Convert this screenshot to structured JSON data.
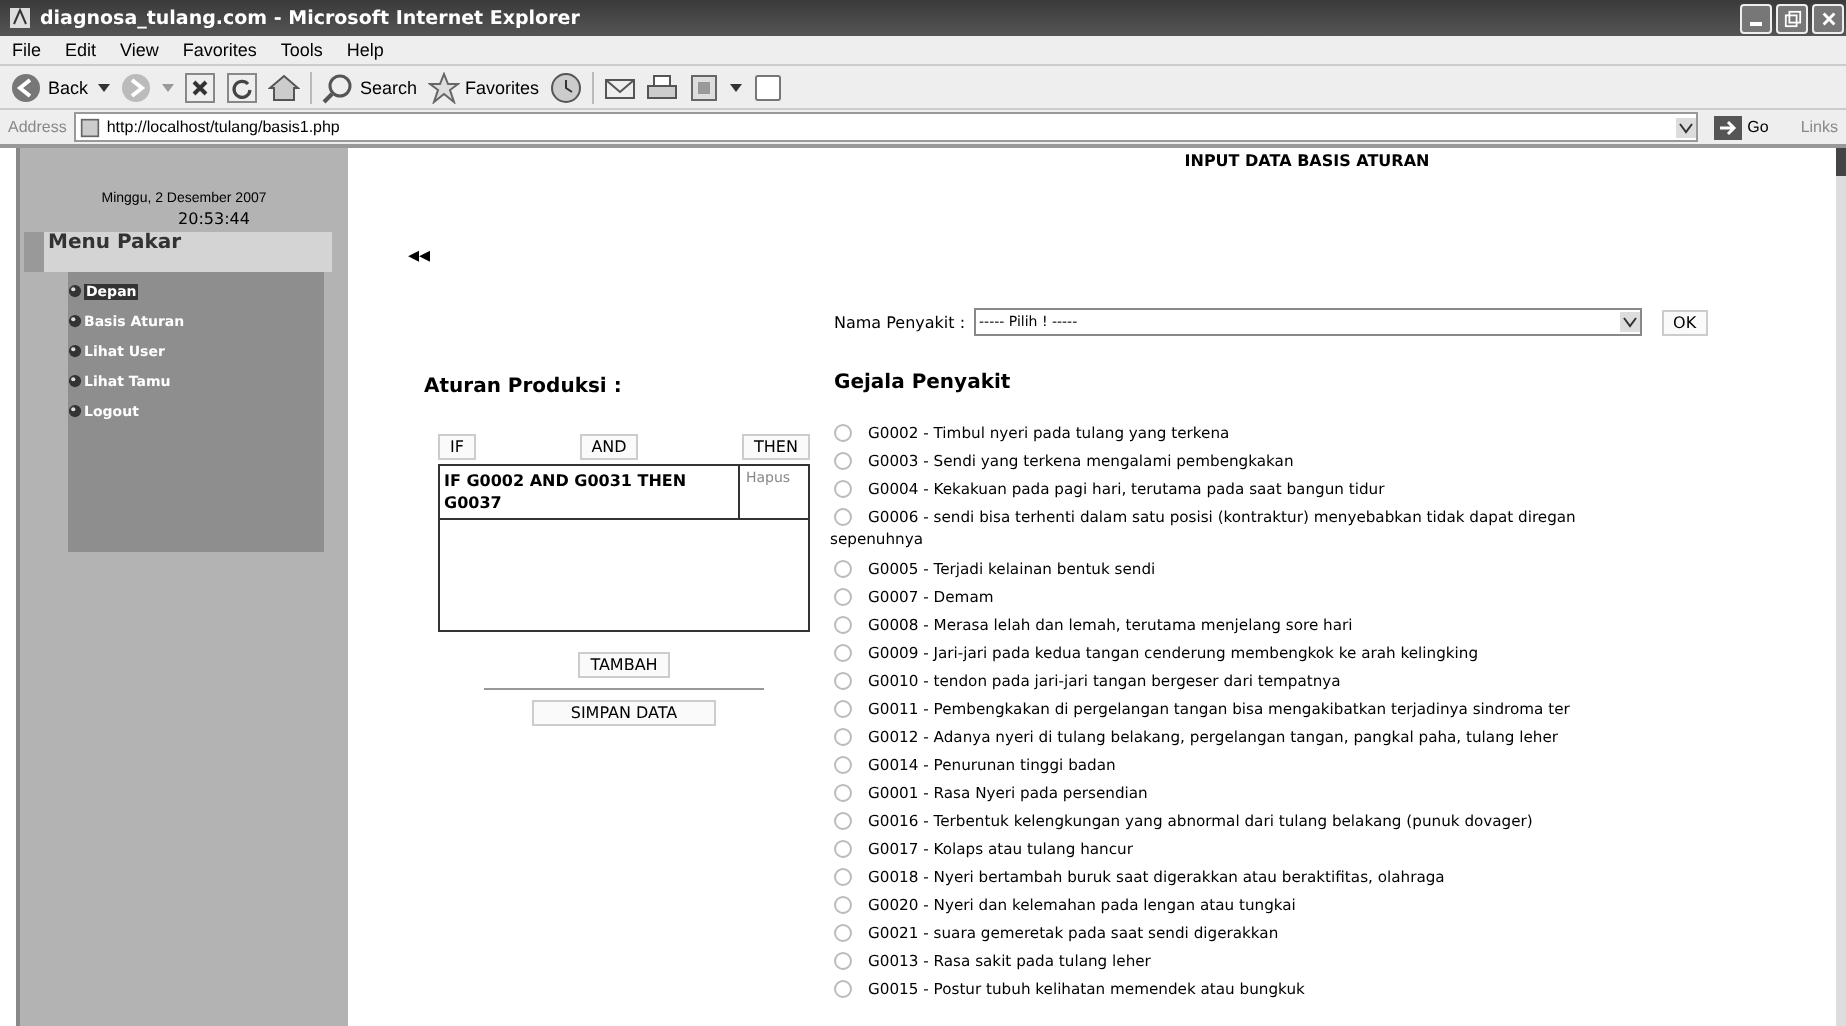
{
  "window": {
    "title": "diagnosa_tulang.com - Microsoft Internet Explorer"
  },
  "menu_bar": [
    "File",
    "Edit",
    "View",
    "Favorites",
    "Tools",
    "Help"
  ],
  "toolbar": {
    "back": "Back",
    "search": "Search",
    "favorites": "Favorites"
  },
  "address_bar": {
    "label": "Address",
    "url": "http://localhost/tulang/basis1.php",
    "go": "Go",
    "links": "Links"
  },
  "sidebar": {
    "date": "Minggu, 2 Desember 2007",
    "time": "20:53:44",
    "menu_title": "Menu Pakar",
    "items": [
      {
        "label": "Depan",
        "selected": true
      },
      {
        "label": "Basis Aturan",
        "selected": false
      },
      {
        "label": "Lihat User",
        "selected": false
      },
      {
        "label": "Lihat Tamu",
        "selected": false
      },
      {
        "label": "Logout",
        "selected": false
      }
    ]
  },
  "page": {
    "title": "INPUT DATA BASIS ATURAN",
    "back_arrows": "◂◂"
  },
  "disease_select": {
    "label": "Nama Penyakit :",
    "value": "----- Pilih ! -----",
    "ok": "OK"
  },
  "rules": {
    "heading": "Aturan Produksi :",
    "header_buttons": [
      "IF",
      "AND",
      "THEN"
    ],
    "rows": [
      {
        "rule": "IF G0002 AND G0031 THEN G0037",
        "action": "Hapus"
      }
    ],
    "add": "TAMBAH",
    "save": "SIMPAN DATA"
  },
  "symptoms": {
    "heading": "Gejala Penyakit",
    "items": [
      {
        "text": "G0002 - Timbul nyeri pada tulang yang terkena",
        "selected": false
      },
      {
        "text": "G0003 - Sendi yang terkena mengalami pembengkakan",
        "selected": false
      },
      {
        "text": "G0004 - Kekakuan pada pagi hari, terutama pada saat bangun tidur",
        "selected": false
      },
      {
        "text": "G0006 - sendi bisa terhenti dalam satu posisi (kontraktur) menyebabkan tidak dapat diregan",
        "continuation": "sepenuhnya",
        "selected": false
      },
      {
        "text": "G0005 - Terjadi kelainan bentuk sendi",
        "selected": false
      },
      {
        "text": "G0007 - Demam",
        "selected": false
      },
      {
        "text": "G0008 - Merasa lelah dan lemah, terutama menjelang sore hari",
        "selected": false
      },
      {
        "text": "G0009 - Jari-jari pada kedua tangan cenderung membengkok ke arah kelingking",
        "selected": false
      },
      {
        "text": "G0010 - tendon pada jari-jari tangan bergeser dari tempatnya",
        "selected": false
      },
      {
        "text": "G0011 - Pembengkakan di pergelangan tangan bisa mengakibatkan terjadinya sindroma ter",
        "selected": false
      },
      {
        "text": "G0012 - Adanya nyeri di tulang belakang, pergelangan tangan, pangkal paha, tulang leher",
        "selected": false
      },
      {
        "text": "G0014 - Penurunan tinggi badan",
        "selected": false
      },
      {
        "text": "G0001 - Rasa Nyeri pada persendian",
        "selected": false
      },
      {
        "text": "G0016 - Terbentuk kelengkungan yang abnormal dari tulang belakang (punuk dovager)",
        "selected": false
      },
      {
        "text": "G0017 - Kolaps atau tulang hancur",
        "selected": false
      },
      {
        "text": "G0018 - Nyeri bertambah buruk saat digerakkan atau beraktifitas, olahraga",
        "selected": false
      },
      {
        "text": "G0020 - Nyeri dan kelemahan pada lengan atau tungkai",
        "selected": false
      },
      {
        "text": "G0021 - suara gemeretak pada saat sendi digerakkan",
        "selected": false
      },
      {
        "text": "G0013 - Rasa sakit pada tulang leher",
        "selected": false
      },
      {
        "text": "G0015 - Postur tubuh kelihatan memendek atau bungkuk",
        "selected": false
      }
    ]
  }
}
